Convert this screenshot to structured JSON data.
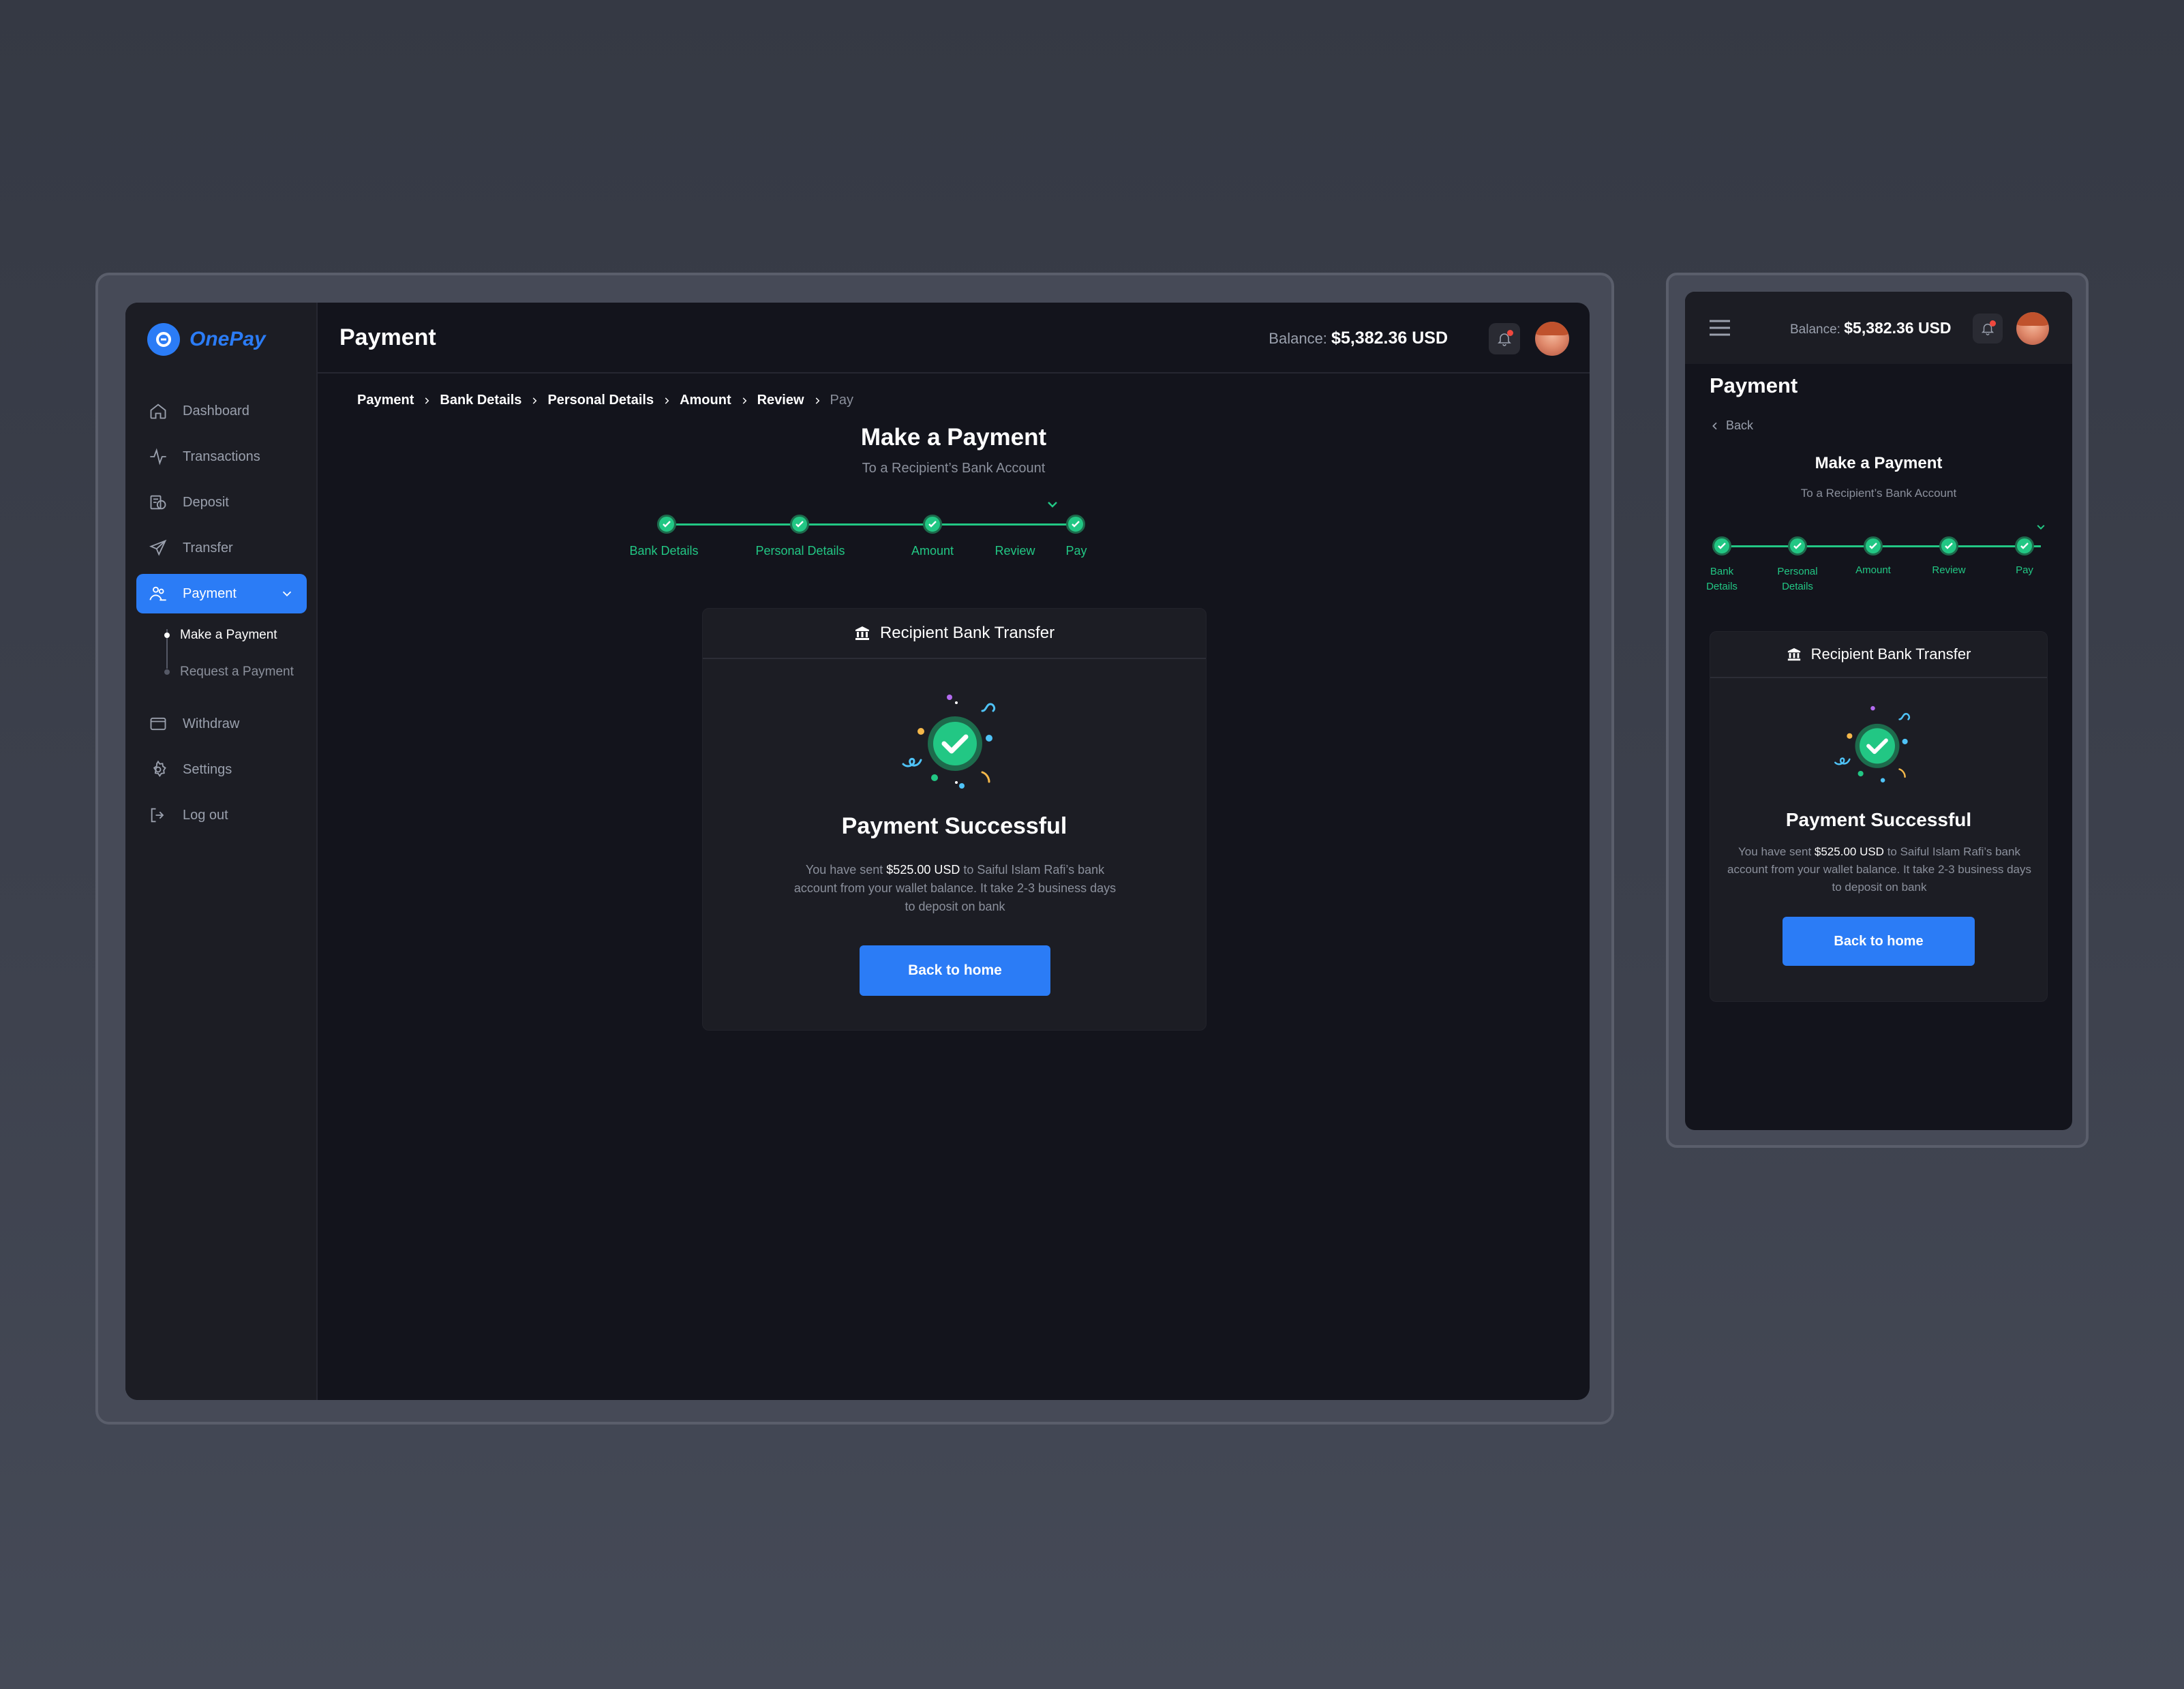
{
  "app": {
    "name": "OnePay"
  },
  "sidebar": {
    "items": [
      {
        "label": "Dashboard",
        "icon": "home-icon"
      },
      {
        "label": "Transactions",
        "icon": "activity-icon"
      },
      {
        "label": "Deposit",
        "icon": "deposit-icon"
      },
      {
        "label": "Transfer",
        "icon": "send-icon"
      },
      {
        "label": "Payment",
        "icon": "payment-icon",
        "active": true
      },
      {
        "label": "Withdraw",
        "icon": "wallet-icon"
      },
      {
        "label": "Settings",
        "icon": "gear-icon"
      },
      {
        "label": "Log out",
        "icon": "logout-icon"
      }
    ],
    "sub_items": [
      {
        "label": "Make a Payment",
        "current": true
      },
      {
        "label": "Request a Payment",
        "current": false
      }
    ]
  },
  "header": {
    "title": "Payment",
    "balance_label": "Balance:",
    "balance_value": "$5,382.36 USD"
  },
  "breadcrumb": [
    "Payment",
    "Bank Details",
    "Personal Details",
    "Amount",
    "Review",
    "Pay"
  ],
  "main": {
    "heading": "Make a Payment",
    "subheading": "To a Recipient’s Bank Account",
    "steps": [
      "Bank Details",
      "Personal Details",
      "Amount",
      "Review",
      "Pay"
    ],
    "card_title": "Recipient Bank Transfer",
    "success_title": "Payment Successful",
    "success_pre": "You have sent ",
    "success_amount": "$525.00 USD",
    "success_post": " to Saiful Islam Rafi’s bank account from your wallet balance. It take 2-3 business days to deposit on bank",
    "button": "Back to home"
  },
  "mobile": {
    "balance_label": "Balance:",
    "balance_value": "$5,382.36 USD",
    "title": "Payment",
    "back": "Back",
    "steps": [
      "Bank\nDetails",
      "Personal\nDetails",
      "Amount",
      "Review",
      "Pay"
    ]
  },
  "colors": {
    "accent": "#2b7cf6",
    "success": "#22c784",
    "background": "#13141c",
    "panel": "#1c1d24"
  }
}
